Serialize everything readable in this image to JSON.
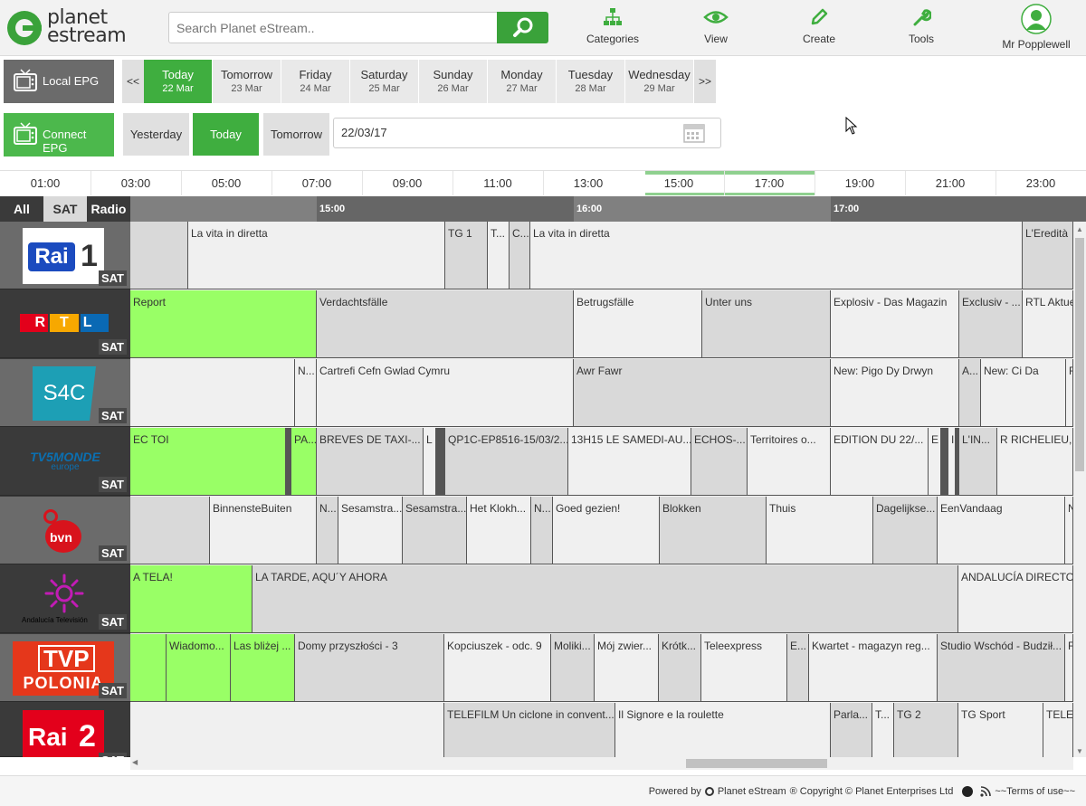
{
  "header": {
    "logo_text": "planet estream",
    "search_placeholder": "Search Planet eStream..",
    "nav": [
      {
        "label": "Categories",
        "icon": "sitemap-icon"
      },
      {
        "label": "View",
        "icon": "eye-icon"
      },
      {
        "label": "Create",
        "icon": "pencil-icon"
      },
      {
        "label": "Tools",
        "icon": "wrench-icon"
      },
      {
        "label": "Mr Popplewell",
        "icon": "user-avatar-icon"
      }
    ]
  },
  "epg": {
    "local_label": "Local EPG",
    "connect_label": "Connect EPG",
    "prev": "<<",
    "next": ">>",
    "days": [
      {
        "name": "Today",
        "date": "22 Mar",
        "active": true
      },
      {
        "name": "Tomorrow",
        "date": "23 Mar"
      },
      {
        "name": "Friday",
        "date": "24 Mar"
      },
      {
        "name": "Saturday",
        "date": "25 Mar"
      },
      {
        "name": "Sunday",
        "date": "26 Mar"
      },
      {
        "name": "Monday",
        "date": "27 Mar"
      },
      {
        "name": "Tuesday",
        "date": "28 Mar"
      },
      {
        "name": "Wednesday",
        "date": "29 Mar"
      }
    ],
    "quick": {
      "yesterday": "Yesterday",
      "today": "Today",
      "tomorrow": "Tomorrow"
    },
    "date_value": "22/03/17"
  },
  "ruler": [
    "01:00",
    "03:00",
    "05:00",
    "07:00",
    "09:00",
    "11:00",
    "13:00",
    "15:00",
    "17:00",
    "19:00",
    "21:00",
    "23:00"
  ],
  "filters": [
    "All",
    "SAT",
    "Radio"
  ],
  "timeline": [
    "15:00",
    "16:00",
    "17:00"
  ],
  "sat_label": "SAT",
  "channels": [
    {
      "name": "Rai 1",
      "logo_text": "Rai",
      "logo_num": "1"
    },
    {
      "name": "RTL",
      "logo_text": "RTL"
    },
    {
      "name": "S4C",
      "logo_text": "S4C"
    },
    {
      "name": "TV5MONDE europe",
      "logo_text": "TV5MONDE",
      "logo_sub": "europe"
    },
    {
      "name": "BVN",
      "logo_text": "bvn"
    },
    {
      "name": "Andalucía Televisión",
      "logo_text": "Andalucía Televisión"
    },
    {
      "name": "TVP Polonia",
      "logo_text": "TVP",
      "logo_sub": "POLONIA"
    },
    {
      "name": "Rai 2",
      "logo_text": "Rai",
      "logo_num": "2"
    }
  ],
  "rows": [
    [
      {
        "t": "",
        "s": "d"
      },
      {
        "t": "La vita in diretta",
        "s": ""
      },
      {
        "t": "TG 1",
        "s": "d"
      },
      {
        "t": "T...",
        "s": ""
      },
      {
        "t": "C...",
        "s": "d"
      },
      {
        "t": "La vita in diretta",
        "s": ""
      },
      {
        "t": "L'Eredità",
        "s": "d"
      }
    ],
    [
      {
        "t": "Report",
        "s": "g"
      },
      {
        "t": "Verdachtsfälle",
        "s": "d"
      },
      {
        "t": "Betrugsfälle",
        "s": ""
      },
      {
        "t": "Unter uns",
        "s": "d"
      },
      {
        "t": "Explosiv - Das Magazin",
        "s": ""
      },
      {
        "t": "Exclusiv - ...",
        "s": "d"
      },
      {
        "t": "RTL Aktuell",
        "s": ""
      }
    ],
    [
      {
        "t": "",
        "s": ""
      },
      {
        "t": "N...",
        "s": ""
      },
      {
        "t": "Cartrefi Cefn Gwlad Cymru",
        "s": ""
      },
      {
        "t": "Awr Fawr",
        "s": "d"
      },
      {
        "t": "New: Pigo Dy Drwyn",
        "s": ""
      },
      {
        "t": "A...",
        "s": "d"
      },
      {
        "t": "New: Ci Da",
        "s": ""
      },
      {
        "t": "F",
        "s": ""
      }
    ],
    [
      {
        "t": "EC TOI",
        "s": "g"
      },
      {
        "t": "",
        "s": "k"
      },
      {
        "t": "PA...",
        "s": "g"
      },
      {
        "t": "BREVES DE TAXI-...",
        "s": "d"
      },
      {
        "t": "L",
        "s": ""
      },
      {
        "t": "",
        "s": "k"
      },
      {
        "t": "QP1C-EP8516-15/03/2...",
        "s": "d"
      },
      {
        "t": "13H15 LE SAMEDI-AU...",
        "s": ""
      },
      {
        "t": "ECHOS-...",
        "s": "d"
      },
      {
        "t": "Territoires o...",
        "s": ""
      },
      {
        "t": "EDITION DU 22/...",
        "s": ""
      },
      {
        "t": "E",
        "s": ""
      },
      {
        "t": "",
        "s": "k"
      },
      {
        "t": "I",
        "s": ""
      },
      {
        "t": "",
        "s": "k"
      },
      {
        "t": "L'IN...",
        "s": "d"
      },
      {
        "t": "R RICHELIEU, L...",
        "s": ""
      }
    ],
    [
      {
        "t": "",
        "s": "d"
      },
      {
        "t": "BinnensteBuiten",
        "s": ""
      },
      {
        "t": "N...",
        "s": "d"
      },
      {
        "t": "Sesamstra...",
        "s": ""
      },
      {
        "t": "Sesamstra...",
        "s": "d"
      },
      {
        "t": "Het Klokh...",
        "s": ""
      },
      {
        "t": "N...",
        "s": "d"
      },
      {
        "t": "Goed gezien!",
        "s": ""
      },
      {
        "t": "Blokken",
        "s": "d"
      },
      {
        "t": "Thuis",
        "s": ""
      },
      {
        "t": "Dagelijkse...",
        "s": "d"
      },
      {
        "t": "EenVandaag",
        "s": ""
      },
      {
        "t": "N",
        "s": ""
      }
    ],
    [
      {
        "t": "A TELA!",
        "s": "g"
      },
      {
        "t": "LA TARDE, AQU´Y AHORA",
        "s": "d"
      },
      {
        "t": "ANDALUCÍA DIRECTO",
        "s": ""
      }
    ],
    [
      {
        "t": "",
        "s": "g"
      },
      {
        "t": "Wiadomo...",
        "s": "g"
      },
      {
        "t": "Las bliżej ...",
        "s": "g"
      },
      {
        "t": "Domy przyszłości - 3",
        "s": "d"
      },
      {
        "t": "Kopciuszek - odc. 9",
        "s": ""
      },
      {
        "t": "Moliki...",
        "s": "d"
      },
      {
        "t": "Mój zwier...",
        "s": ""
      },
      {
        "t": "Krótk...",
        "s": "d"
      },
      {
        "t": "Teleexpress",
        "s": ""
      },
      {
        "t": "E...",
        "s": "d"
      },
      {
        "t": "Kwartet - magazyn reg...",
        "s": ""
      },
      {
        "t": "Studio Wschód - Budził...",
        "s": "d"
      },
      {
        "t": "F",
        "s": ""
      }
    ],
    [
      {
        "t": "",
        "s": ""
      },
      {
        "t": "TELEFILM Un ciclone in convent...",
        "s": "d"
      },
      {
        "t": "Il Signore e la roulette",
        "s": ""
      },
      {
        "t": "Parla...",
        "s": "d"
      },
      {
        "t": "T...",
        "s": ""
      },
      {
        "t": "TG 2",
        "s": "d"
      },
      {
        "t": "TG Sport",
        "s": ""
      },
      {
        "t": "TELEF",
        "s": ""
      }
    ]
  ],
  "footer": {
    "powered": "Powered by",
    "brand": "Planet eStream",
    "copyright": "® Copyright © Planet Enterprises Ltd",
    "terms": "~~Terms of use~~"
  },
  "colors": {
    "accent": "#3fae3f",
    "onair": "#99ff66",
    "dark": "#3a3a3a"
  }
}
